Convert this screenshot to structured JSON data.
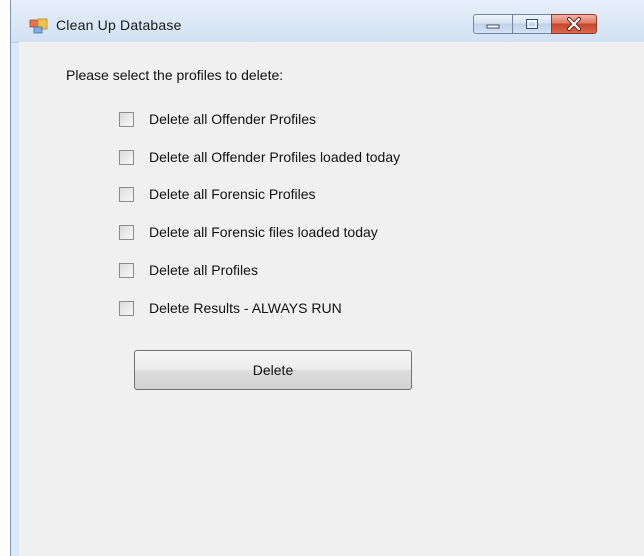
{
  "window": {
    "title": "Clean Up Database",
    "title_icon": "database-app-icon",
    "controls": {
      "minimize_icon": "minimize-icon",
      "maximize_icon": "maximize-icon",
      "close_icon": "close-icon"
    }
  },
  "form": {
    "prompt": "Please select the profiles to delete:",
    "options": [
      {
        "label": "Delete all Offender Profiles",
        "checked": false
      },
      {
        "label": "Delete all Offender Profiles loaded today",
        "checked": false
      },
      {
        "label": "Delete all Forensic Profiles",
        "checked": false
      },
      {
        "label": "Delete all Forensic files loaded today",
        "checked": false
      },
      {
        "label": "Delete all Profiles",
        "checked": false
      },
      {
        "label": "Delete Results - ALWAYS RUN",
        "checked": false
      }
    ],
    "delete_label": "Delete"
  },
  "colors": {
    "title_bar": "#dbe8f6",
    "client_bg": "#f0f0f0",
    "close_button": "#c7452b"
  }
}
